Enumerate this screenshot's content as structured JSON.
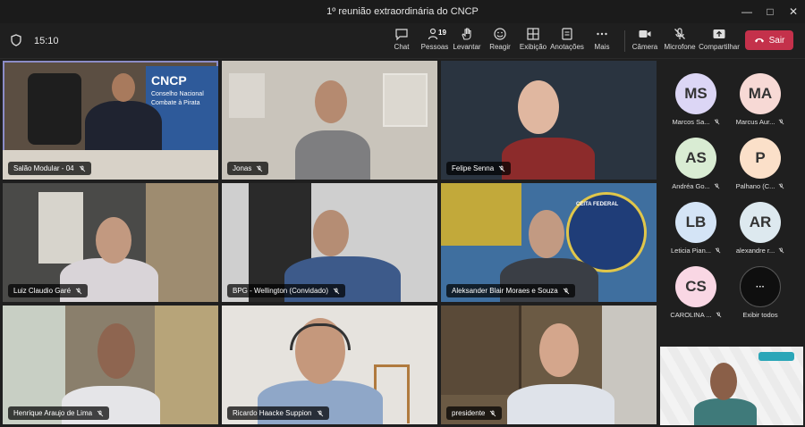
{
  "window": {
    "title": "1º reunião extraordinária do CNCP"
  },
  "toolbar": {
    "time": "15:10",
    "participants_count": "19",
    "buttons": [
      {
        "label": "Chat",
        "icon": "chat-icon"
      },
      {
        "label": "Pessoas",
        "icon": "people-icon"
      },
      {
        "label": "Levantar",
        "icon": "raise-hand-icon"
      },
      {
        "label": "Reagir",
        "icon": "emoji-icon"
      },
      {
        "label": "Exibição",
        "icon": "grid-view-icon"
      },
      {
        "label": "Anotações",
        "icon": "notes-icon"
      },
      {
        "label": "Mais",
        "icon": "more-icon"
      },
      {
        "label": "Câmera",
        "icon": "camera-icon"
      },
      {
        "label": "Microfone",
        "icon": "mic-off-icon"
      },
      {
        "label": "Compartilhar",
        "icon": "share-icon"
      }
    ],
    "leave_label": "Sair"
  },
  "tiles": [
    {
      "name": "Salão Modular - 04",
      "bg": "#2e5a9a",
      "sign1": "CNCP",
      "sign2": "Conselho Nacional",
      "sign3": "Combate à Pirata"
    },
    {
      "name": "Jonas",
      "bg": "#c9c4bb"
    },
    {
      "name": "Felipe Senna",
      "bg": "#2a3440"
    },
    {
      "name": "Luiz Claudio Garé",
      "bg": "#4a4a48"
    },
    {
      "name": "BPG - Wellington (Convidado)",
      "bg": "#cfcfcf"
    },
    {
      "name": "Aleksander Blair Moraes e Souza",
      "bg": "#3f6f9f",
      "sign1": "CEITA FEDERAL"
    },
    {
      "name": "Henrique Araujo de Lima",
      "bg": "#8a7f6c"
    },
    {
      "name": "Ricardo Haacke Suppion",
      "bg": "#e6e3de"
    },
    {
      "name": "presidente",
      "bg": "#6b5a44"
    }
  ],
  "side_participants": [
    {
      "initials": "MS",
      "name": "Marcos Sa...",
      "color": "#dcd6f5"
    },
    {
      "initials": "MA",
      "name": "Marcus Aur...",
      "color": "#f7d9d5"
    },
    {
      "initials": "AS",
      "name": "Andréa Go...",
      "color": "#d9ecd3"
    },
    {
      "initials": "P",
      "name": "Palhano (C...",
      "color": "#fbe0c9"
    },
    {
      "initials": "LB",
      "name": "Leticia Pian...",
      "color": "#d4e4f6"
    },
    {
      "initials": "AR",
      "name": "alexandre r...",
      "color": "#dde9ef"
    },
    {
      "initials": "CS",
      "name": "CAROLINA ...",
      "color": "#f9d7e4"
    },
    {
      "initials": "···",
      "name": "Exibir todos",
      "color": "#0f0f0f"
    }
  ]
}
